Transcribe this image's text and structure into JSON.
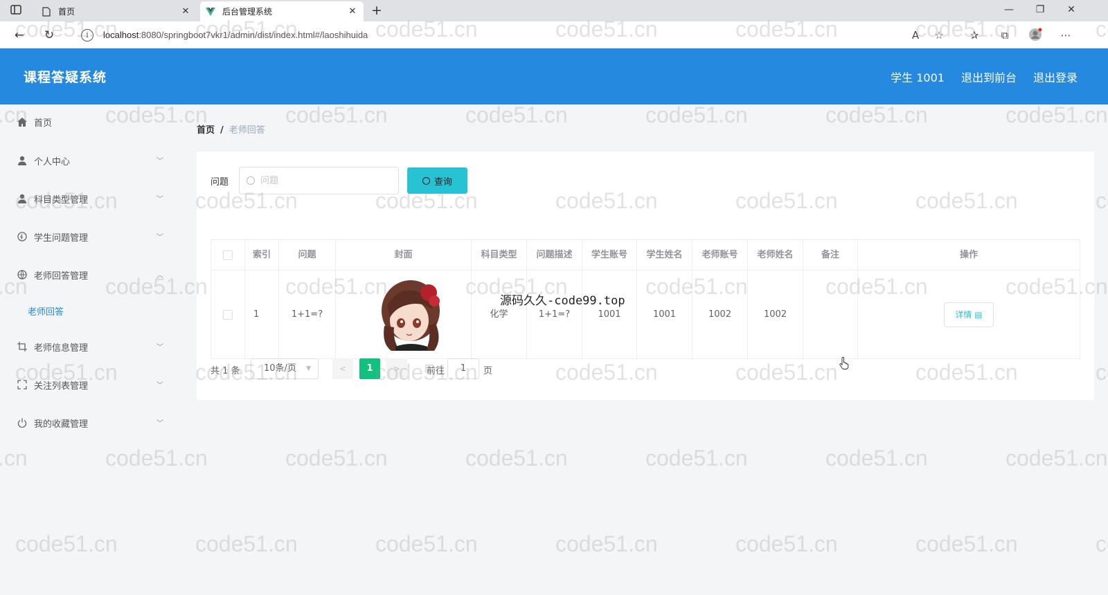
{
  "browser": {
    "tabs": [
      {
        "title": "首页",
        "active": false
      },
      {
        "title": "后台管理系统",
        "active": true
      }
    ],
    "url_host": "localhost",
    "url_rest": ":8080/springboot7vkr1/admin/dist/index.html#/laoshihuida",
    "icons": [
      "sidebar-toggle-icon",
      "page-icon",
      "vue-logo-icon",
      "close-icon",
      "new-tab-icon",
      "back-icon",
      "refresh-icon",
      "info-icon",
      "read-aloud-icon",
      "add-favorite-icon",
      "favorites-icon",
      "collections-icon",
      "profile-icon",
      "more-icon"
    ]
  },
  "header": {
    "title": "课程答疑系统",
    "user": "学生 1001",
    "to_front": "退出到前台",
    "logout": "退出登录",
    "bg_color": "#2589e0"
  },
  "sidebar": {
    "items": [
      {
        "label": "首页",
        "icon": "home-icon"
      },
      {
        "label": "个人中心",
        "icon": "user-icon"
      },
      {
        "label": "科目类型管理",
        "icon": "user-icon"
      },
      {
        "label": "学生问题管理",
        "icon": "help-icon"
      },
      {
        "label": "老师回答管理",
        "icon": "globe-icon"
      },
      {
        "label": "老师信息管理",
        "icon": "crop-icon"
      },
      {
        "label": "关注列表管理",
        "icon": "fullscreen-icon"
      },
      {
        "label": "我的收藏管理",
        "icon": "power-icon"
      }
    ],
    "sub_item": "老师回答"
  },
  "breadcrumb": {
    "home": "首页",
    "sep": "/",
    "current": "老师回答"
  },
  "search": {
    "label": "问题",
    "placeholder": "问题",
    "button": "查询"
  },
  "table": {
    "columns": [
      "索引",
      "问题",
      "封面",
      "科目类型",
      "问题描述",
      "学生账号",
      "学生姓名",
      "老师账号",
      "老师姓名",
      "备注",
      "操作"
    ],
    "rows": [
      {
        "index": "1",
        "question": "1+1=?",
        "subject": "化学",
        "desc": "1+1=?",
        "student_account": "1001",
        "student_name": "1001",
        "teacher_account": "1002",
        "teacher_name": "1002",
        "remark": "",
        "action": "详情"
      }
    ]
  },
  "overlay": "源码久久-code99.top",
  "pager": {
    "total": "共 1 条",
    "size": "10条/页",
    "current": "1",
    "goto": "前往",
    "goto_value": "1",
    "page": "页",
    "active_color": "#13c17f"
  },
  "watermark": "code51.cn"
}
